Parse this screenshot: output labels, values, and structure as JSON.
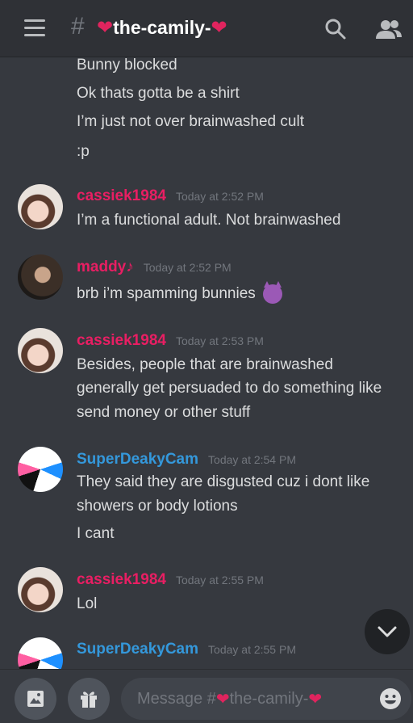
{
  "header": {
    "channel_name": "the-camily-",
    "heart_glyph": "❤"
  },
  "messages": {
    "continuation_lines": [
      "Bunny blocked",
      "Ok thats gotta be a shirt",
      "I’m just not over brainwashed cult",
      ":p"
    ],
    "groups": [
      {
        "author": "cassiek1984",
        "timestamp": "Today at 2:52 PM",
        "lines": [
          "I’m a functional adult. Not brainwashed"
        ]
      },
      {
        "author": "maddy♪",
        "timestamp": "Today at 2:52 PM",
        "lines": [
          "brb i’m spamming bunnies"
        ]
      },
      {
        "author": "cassiek1984",
        "timestamp": "Today at 2:53 PM",
        "lines": [
          "Besides, people that are brainwashed",
          "generally get persuaded to do something like",
          "send money or other stuff"
        ]
      },
      {
        "author": "SuperDeakyCam",
        "timestamp": "Today at 2:54 PM",
        "lines": [
          "They said they are disgusted cuz i dont like",
          "showers or body lotions",
          "I cant"
        ]
      },
      {
        "author": "cassiek1984",
        "timestamp": "Today at 2:55 PM",
        "lines": [
          "Lol"
        ]
      },
      {
        "author": "SuperDeakyCam",
        "timestamp": "Today at 2:55 PM",
        "lines": []
      }
    ]
  },
  "composer": {
    "placeholder_prefix": "Message #",
    "placeholder_channel": "the-camily-"
  },
  "colors": {
    "background": "#36393f",
    "header": "#2f3136",
    "pink_role": "#e91e63",
    "blue_role": "#3498db",
    "timestamp": "#72767d"
  },
  "icons": [
    "menu-icon",
    "hash-icon",
    "search-icon",
    "members-icon",
    "chevron-down-icon",
    "image-icon",
    "gift-icon",
    "emoji-icon"
  ]
}
